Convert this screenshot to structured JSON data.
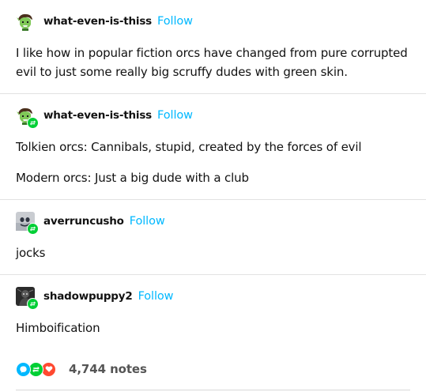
{
  "posts": [
    {
      "username": "what-even-is-thiss",
      "follow_label": "Follow",
      "avatar_icon": "green-orc-avatar-icon",
      "reblog_badge": false,
      "paragraphs": [
        "I like how in popular fiction orcs have changed from pure corrupted evil to just some really big scruffy dudes with green skin."
      ]
    },
    {
      "username": "what-even-is-thiss",
      "follow_label": "Follow",
      "avatar_icon": "green-orc-avatar-icon",
      "reblog_badge": true,
      "paragraphs": [
        "Tolkien orcs: Cannibals, stupid, created by the forces of evil",
        "Modern orcs: Just a big dude with a club"
      ]
    },
    {
      "username": "averruncusho",
      "follow_label": "Follow",
      "avatar_icon": "grey-face-avatar-icon",
      "reblog_badge": true,
      "paragraphs": [
        "jocks"
      ]
    },
    {
      "username": "shadowpuppy2",
      "follow_label": "Follow",
      "avatar_icon": "dark-figure-avatar-icon",
      "reblog_badge": true,
      "paragraphs": [
        "Himboification"
      ]
    }
  ],
  "notes": {
    "count_label": "4,744 notes",
    "icons": [
      "comment-icon",
      "reblog-icon",
      "heart-icon"
    ]
  },
  "colors": {
    "follow": "#00b8ff",
    "reblog_badge": "#00cf35",
    "comment": "#00b8ff",
    "reblog": "#00cf35",
    "like": "#ff4930"
  }
}
